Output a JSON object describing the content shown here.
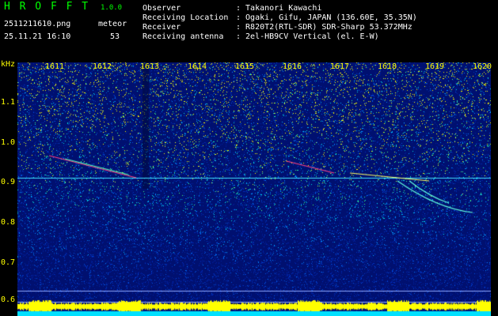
{
  "app": {
    "logo": "H R O F F T",
    "version": "1.0.0",
    "filename": "2511211610.png",
    "mode": "meteor",
    "datetime": "25.11.21 16:10",
    "count": "53"
  },
  "info": {
    "observer_label": "Observer",
    "observer_value": ": Takanori Kawachi",
    "location_label": "Receiving Location",
    "location_value": ": Ogaki, Gifu, JAPAN (136.60E, 35.35N)",
    "receiver_label": "Receiver",
    "receiver_value": ": R820T2(RTL-SDR) SDR-Sharp 53.372MHz",
    "antenna_label": "Receiving antenna",
    "antenna_value": ": 2el-HB9CV Vertical (el. E-W)"
  },
  "axes": {
    "yunit": "kHz",
    "xticks": [
      "1611",
      "1612",
      "1613",
      "1614",
      "1615",
      "1616",
      "1617",
      "1618",
      "1619",
      "1620"
    ],
    "yticks": [
      "1.1",
      "1.0",
      "0.9",
      "0.8",
      "0.7",
      "0.6"
    ]
  },
  "colors": {
    "background": "#000000",
    "text_green": "#00ff00",
    "text_yellow": "#ffff00",
    "spectro_base": "#001a8c"
  }
}
